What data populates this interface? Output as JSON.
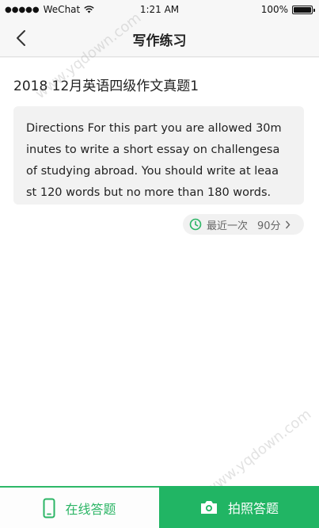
{
  "status_bar": {
    "carrier": "WeChat",
    "time": "1:21 AM",
    "battery": "100%"
  },
  "nav": {
    "title": "写作练习"
  },
  "essay": {
    "title": "2018 12月英语四级作文真题1",
    "directions_lines": [
      "Directions For this part you are allowed 30m",
      "inutes to write a short essay on challengesa",
      "of studying abroad. You should write at leaa",
      "st 120 words but no more than 180 words."
    ]
  },
  "recent": {
    "label": "最近一次",
    "score": "90分"
  },
  "bottom": {
    "online_label": "在线答题",
    "photo_label": "拍照答题"
  },
  "watermark": {
    "text": "www.yqdown.com"
  },
  "colors": {
    "accent_green": "#21b564",
    "text_dark": "#222222",
    "chip_text": "#666666"
  }
}
